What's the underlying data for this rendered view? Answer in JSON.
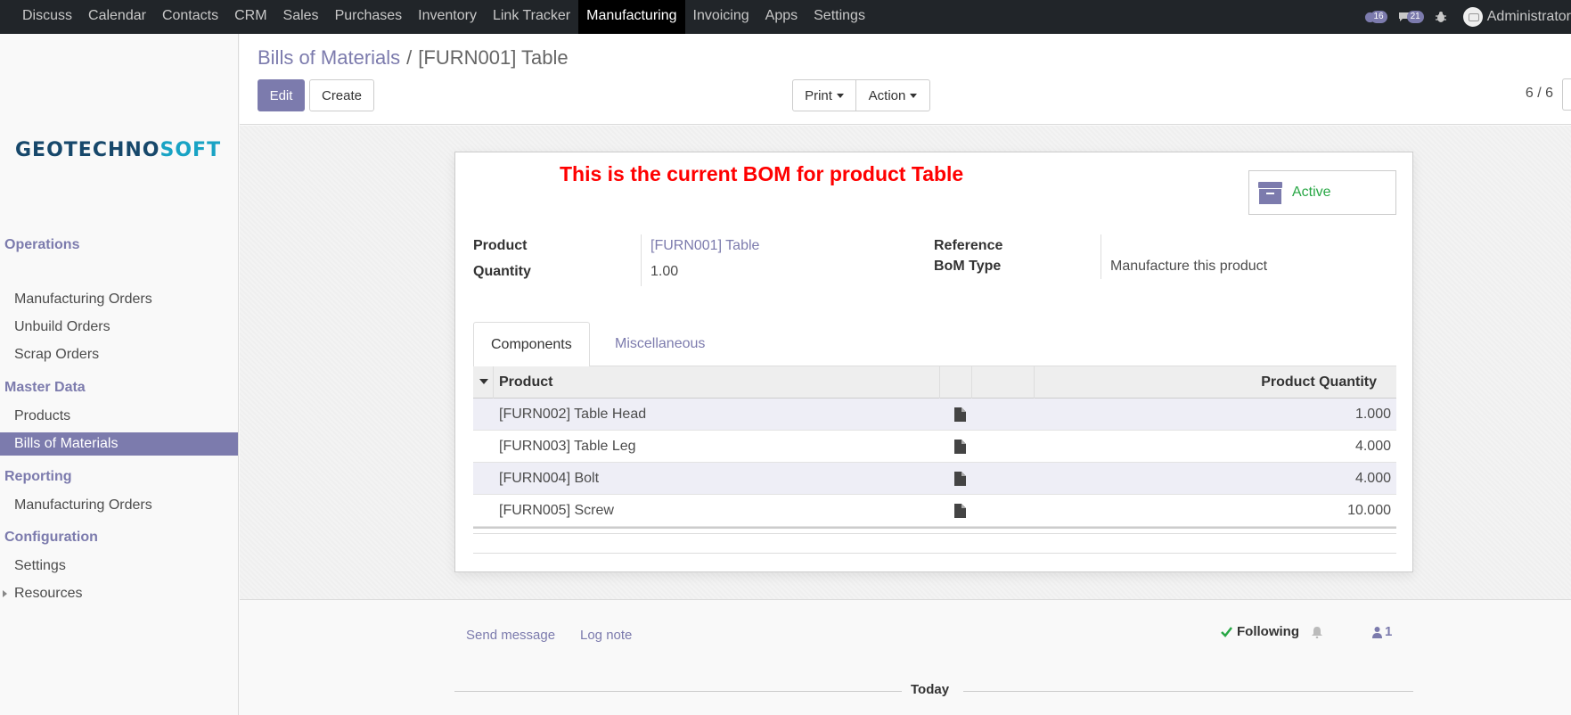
{
  "topbar": {
    "menu": [
      "Discuss",
      "Calendar",
      "Contacts",
      "CRM",
      "Sales",
      "Purchases",
      "Inventory",
      "Link Tracker",
      "Manufacturing",
      "Invoicing",
      "Apps",
      "Settings"
    ],
    "active_menu": "Manufacturing",
    "activity_count": "16",
    "message_count": "21",
    "user_name": "Administrator"
  },
  "sidebar": {
    "logo_part1": "GEOTECHNO",
    "logo_part2": "SOFT",
    "sections": [
      {
        "title": "Operations",
        "items": [
          "Manufacturing Orders",
          "Unbuild Orders",
          "Scrap Orders"
        ]
      },
      {
        "title": "Master Data",
        "items": [
          "Products",
          "Bills of Materials"
        ]
      },
      {
        "title": "Reporting",
        "items": [
          "Manufacturing Orders"
        ]
      },
      {
        "title": "Configuration",
        "items": [
          "Settings",
          "Resources"
        ]
      }
    ],
    "active_item": "Bills of Materials"
  },
  "control": {
    "breadcrumb_parent": "Bills of Materials",
    "breadcrumb_sep": "/",
    "breadcrumb_current": "[FURN001] Table",
    "edit_label": "Edit",
    "create_label": "Create",
    "print_label": "Print",
    "action_label": "Action",
    "pager": "6 / 6"
  },
  "form": {
    "notice": "This is the current BOM for product Table",
    "active_label": "Active",
    "product_label": "Product",
    "product_value": "[FURN001] Table",
    "quantity_label": "Quantity",
    "quantity_value": "1.00",
    "reference_label": "Reference",
    "bom_type_label": "BoM Type",
    "bom_type_value": "Manufacture this product",
    "tabs": [
      "Components",
      "Miscellaneous"
    ],
    "active_tab": "Components",
    "columns": {
      "product": "Product",
      "quantity": "Product Quantity"
    },
    "components": [
      {
        "product": "[FURN002] Table Head",
        "qty": "1.000"
      },
      {
        "product": "[FURN003] Table Leg",
        "qty": "4.000"
      },
      {
        "product": "[FURN004] Bolt",
        "qty": "4.000"
      },
      {
        "product": "[FURN005] Screw",
        "qty": "10.000"
      }
    ]
  },
  "chatter": {
    "send_message": "Send message",
    "log_note": "Log note",
    "following": "Following",
    "followers_count": "1",
    "today": "Today"
  },
  "colors": {
    "accent": "#7c7bad",
    "notice": "#ff0000",
    "active": "#28a745",
    "navbar": "#212529"
  }
}
